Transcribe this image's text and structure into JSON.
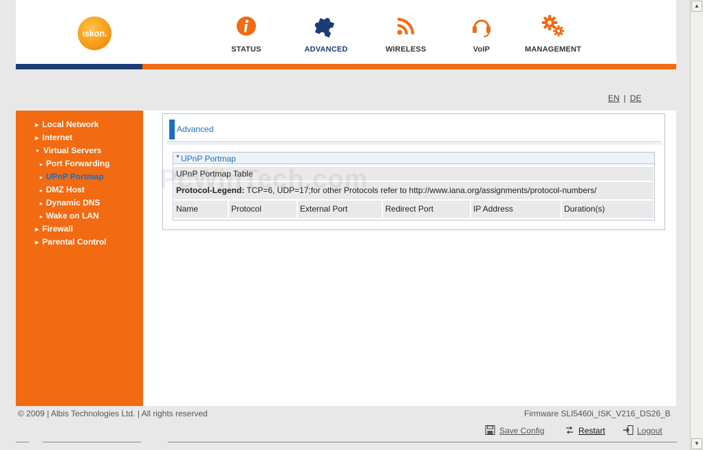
{
  "header": {
    "logo_text": "ıskon.",
    "nav": [
      {
        "label": "STATUS",
        "icon": "info-icon"
      },
      {
        "label": "ADVANCED",
        "icon": "puzzle-icon"
      },
      {
        "label": "WIRELESS",
        "icon": "wifi-signal-icon"
      },
      {
        "label": "VoIP",
        "icon": "headset-icon"
      },
      {
        "label": "MANAGEMENT",
        "icon": "gears-icon"
      }
    ],
    "active_nav": "ADVANCED"
  },
  "language": {
    "en": "EN",
    "separator": "|",
    "de": "DE"
  },
  "sidebar": {
    "items": [
      {
        "label": "Local Network",
        "level": 1,
        "expanded": false
      },
      {
        "label": "Internet",
        "level": 1,
        "expanded": false
      },
      {
        "label": "Virtual Servers",
        "level": 1,
        "expanded": true
      },
      {
        "label": "Port Forwarding",
        "level": 2
      },
      {
        "label": "UPnP Portmap",
        "level": 2,
        "current": true
      },
      {
        "label": "DMZ Host",
        "level": 2
      },
      {
        "label": "Dynamic DNS",
        "level": 2
      },
      {
        "label": "Wake on LAN",
        "level": 2
      },
      {
        "label": "Firewall",
        "level": 1,
        "expanded": false
      },
      {
        "label": "Parental Control",
        "level": 1,
        "expanded": false
      }
    ]
  },
  "main": {
    "page_title": "Advanced",
    "section_title": "UPnP Portmap",
    "table_title": "UPnP Portmap Table",
    "legend_label": "Protocol-Legend:",
    "legend_text": " TCP=6, UDP=17;for other Protocols refer to http://www.iana.org/assignments/protocol-numbers/",
    "columns": [
      "Name",
      "Protocol",
      "External Port",
      "Redirect Port",
      "IP Address",
      "Duration(s)"
    ],
    "rows": []
  },
  "watermark": "PcWinTech.com",
  "footer": {
    "copyright": "© 2009 | Albis Technologies Ltd. | All rights reserved",
    "firmware": "Firmware SLI5460i_ISK_V216_DS26_B",
    "actions": {
      "save": "Save Config",
      "restart": "Restart",
      "logout": "Logout"
    }
  },
  "colors": {
    "brand_orange": "#f26a11",
    "brand_blue": "#1a3d78",
    "link_blue": "#1a6fc4"
  }
}
